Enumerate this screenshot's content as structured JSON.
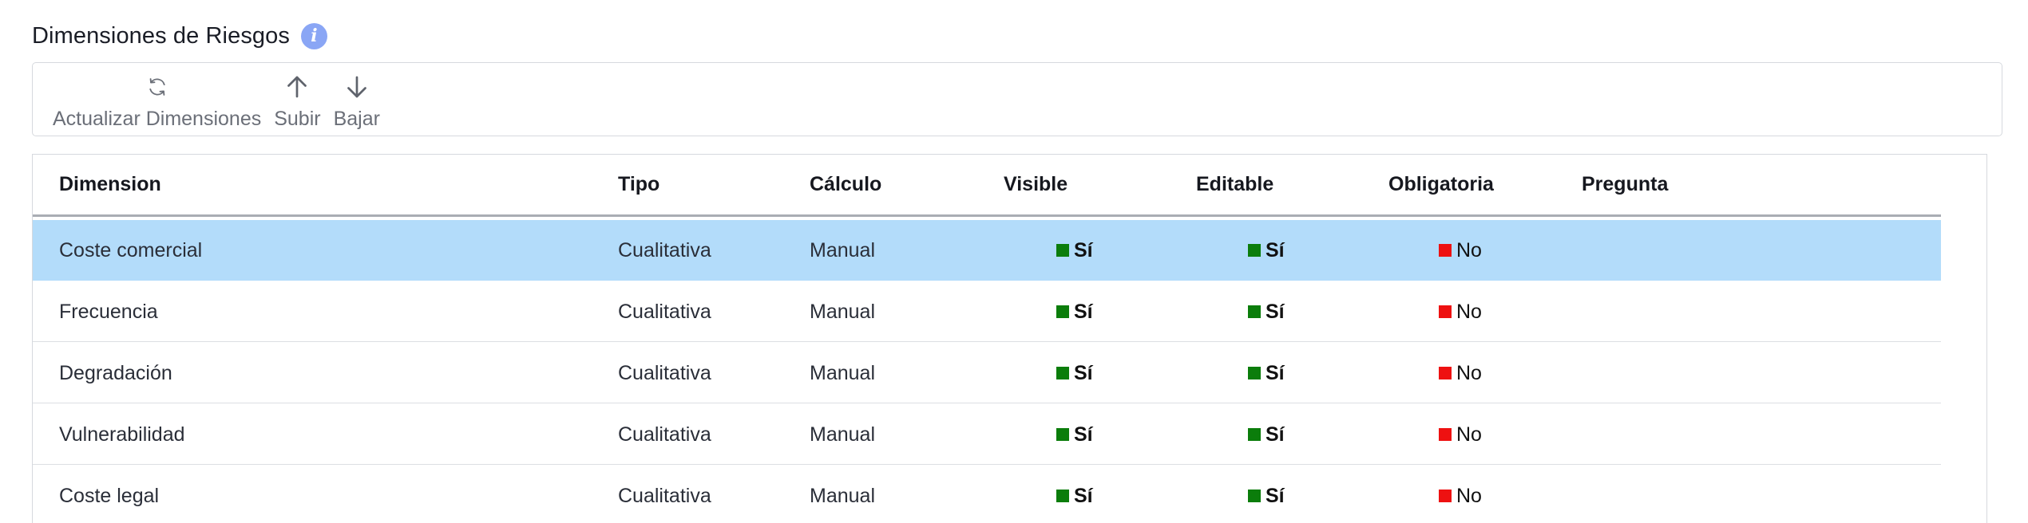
{
  "header": {
    "title": "Dimensiones de Riesgos",
    "info_icon": "info-icon",
    "accent": "#8aa6f5"
  },
  "toolbar": {
    "refresh_label": "Actualizar Dimensiones",
    "up_label": "Subir",
    "down_label": "Bajar"
  },
  "table": {
    "columns": [
      "Dimension",
      "Tipo",
      "Cálculo",
      "Visible",
      "Editable",
      "Obligatoria",
      "Pregunta"
    ],
    "rows": [
      {
        "dimension": "Coste comercial",
        "tipo": "Cualitativa",
        "calculo": "Manual",
        "visible": "Sí",
        "editable": "Sí",
        "obligatoria": "No",
        "pregunta": "",
        "selected": true
      },
      {
        "dimension": "Frecuencia",
        "tipo": "Cualitativa",
        "calculo": "Manual",
        "visible": "Sí",
        "editable": "Sí",
        "obligatoria": "No",
        "pregunta": ""
      },
      {
        "dimension": "Degradación",
        "tipo": "Cualitativa",
        "calculo": "Manual",
        "visible": "Sí",
        "editable": "Sí",
        "obligatoria": "No",
        "pregunta": ""
      },
      {
        "dimension": "Vulnerabilidad",
        "tipo": "Cualitativa",
        "calculo": "Manual",
        "visible": "Sí",
        "editable": "Sí",
        "obligatoria": "No",
        "pregunta": ""
      },
      {
        "dimension": "Coste legal",
        "tipo": "Cualitativa",
        "calculo": "Manual",
        "visible": "Sí",
        "editable": "Sí",
        "obligatoria": "No",
        "pregunta": ""
      }
    ]
  },
  "colors": {
    "yes": "#0b7d0b",
    "no": "#ee1111",
    "selected_row": "#b3dcfa"
  }
}
